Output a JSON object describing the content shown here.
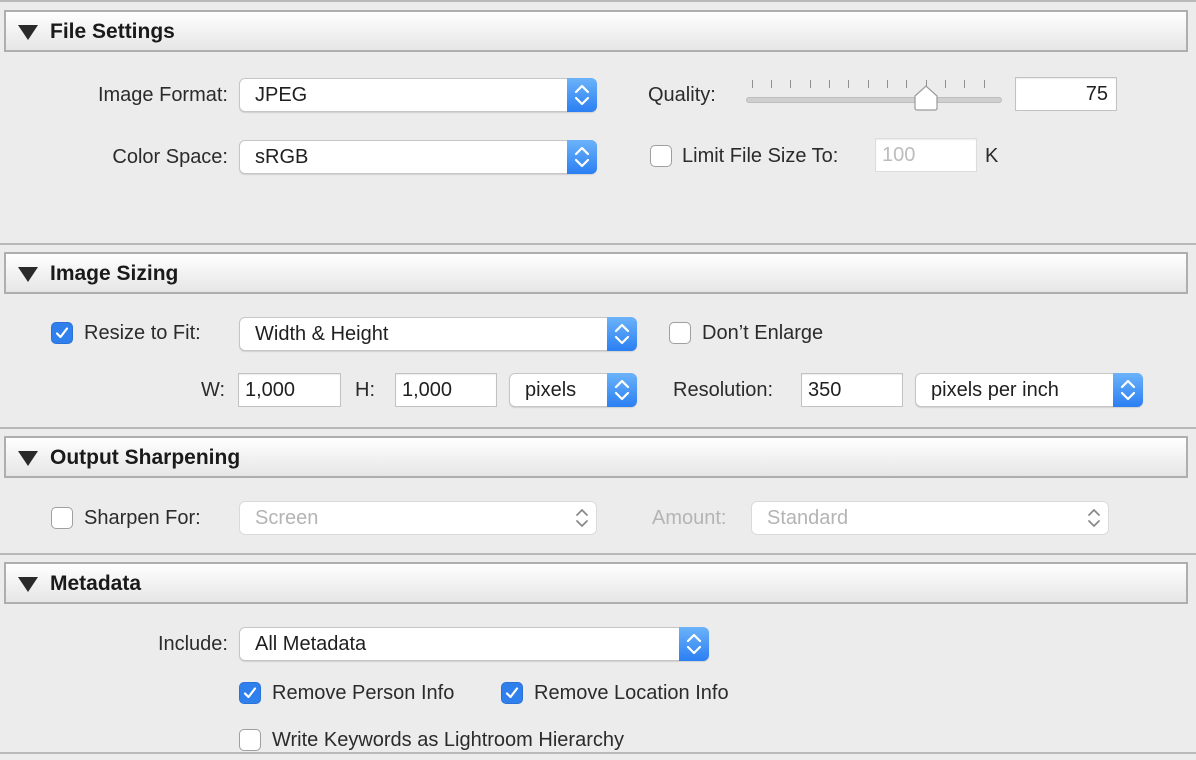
{
  "file_settings": {
    "title": "File Settings",
    "image_format_label": "Image Format:",
    "image_format_value": "JPEG",
    "color_space_label": "Color Space:",
    "color_space_value": "sRGB",
    "quality_label": "Quality:",
    "quality_value": "75",
    "quality_slider_fraction": 0.75,
    "limit_file_size_checked": false,
    "limit_file_size_label": "Limit File Size To:",
    "limit_file_size_value": "100",
    "limit_file_size_unit": "K"
  },
  "image_sizing": {
    "title": "Image Sizing",
    "resize_checked": true,
    "resize_label": "Resize to Fit:",
    "resize_mode": "Width & Height",
    "dont_enlarge_checked": false,
    "dont_enlarge_label": "Don’t Enlarge",
    "w_label": "W:",
    "w_value": "1,000",
    "h_label": "H:",
    "h_value": "1,000",
    "units_value": "pixels",
    "resolution_label": "Resolution:",
    "resolution_value": "350",
    "resolution_units_value": "pixels per inch"
  },
  "output_sharpening": {
    "title": "Output Sharpening",
    "sharpen_checked": false,
    "sharpen_label": "Sharpen For:",
    "sharpen_value": "Screen",
    "amount_label": "Amount:",
    "amount_value": "Standard"
  },
  "metadata": {
    "title": "Metadata",
    "include_label": "Include:",
    "include_value": "All Metadata",
    "remove_person_checked": true,
    "remove_person_label": "Remove Person Info",
    "remove_location_checked": true,
    "remove_location_label": "Remove Location Info",
    "write_keywords_checked": false,
    "write_keywords_label": "Write Keywords as Lightroom Hierarchy"
  },
  "colors": {
    "accent": "#2f80ed",
    "header_border": "#aeaeae",
    "background": "#ececec"
  }
}
